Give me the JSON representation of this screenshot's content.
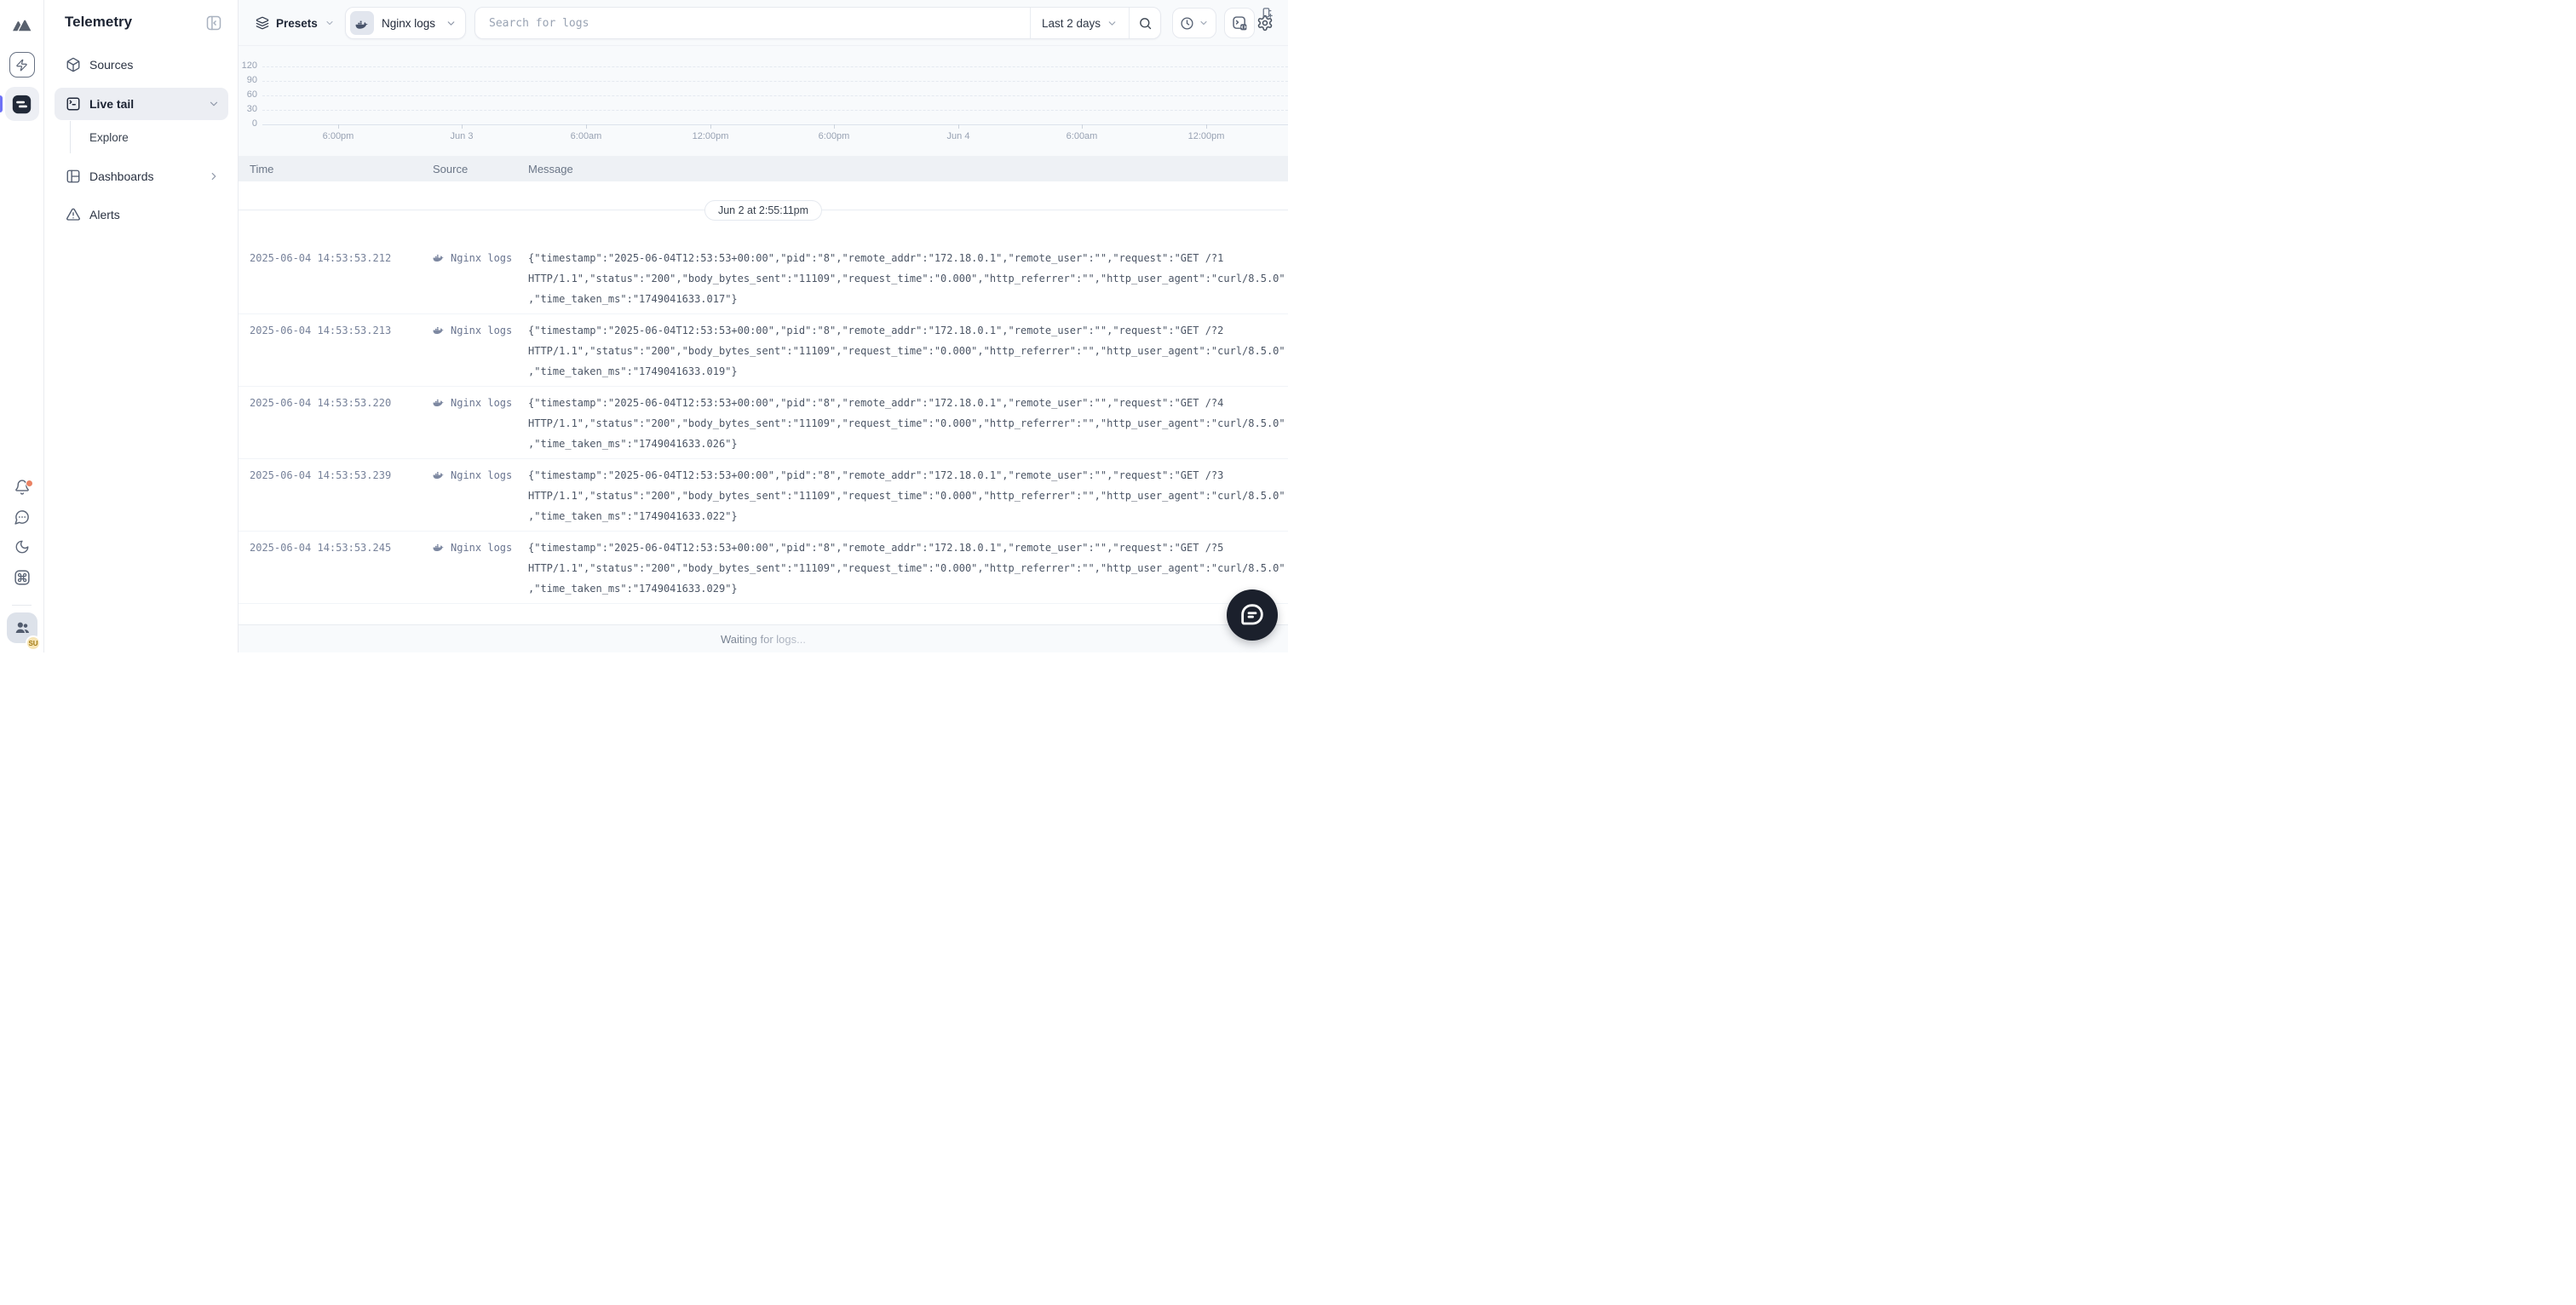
{
  "app": {
    "title": "Telemetry"
  },
  "rail": {
    "avatar_badge": "SU"
  },
  "sidebar": {
    "title": "Telemetry",
    "items": [
      {
        "label": "Sources"
      },
      {
        "label": "Live tail"
      },
      {
        "label": "Explore"
      },
      {
        "label": "Dashboards"
      },
      {
        "label": "Alerts"
      }
    ]
  },
  "topbar": {
    "presets_label": "Presets",
    "source_selector": "Nginx logs",
    "search_placeholder": "Search for logs",
    "time_range": "Last 2 days"
  },
  "chart_data": {
    "type": "bar",
    "title": "",
    "x_ticks": [
      "6:00pm",
      "Jun 3",
      "6:00am",
      "12:00pm",
      "6:00pm",
      "Jun 4",
      "6:00am",
      "12:00pm"
    ],
    "y_ticks": [
      "120",
      "90",
      "60",
      "30",
      "0"
    ],
    "ylim": [
      0,
      120
    ],
    "values": [],
    "grid": "horizontal-dashed",
    "legend": "none",
    "note": "empty histogram, no bars rendered"
  },
  "log_table": {
    "columns": [
      "Time",
      "Source",
      "Message"
    ],
    "date_separator": "Jun 2 at 2:55:11pm",
    "rows": [
      {
        "time": "2025-06-04 14:53:53.212",
        "source": "Nginx logs",
        "message": "{\"timestamp\":\"2025-06-04T12:53:53+00:00\",\"pid\":\"8\",\"remote_addr\":\"172.18.0.1\",\"remote_user\":\"\",\"request\":\"GET /?1 HTTP/1.1\",\"status\":\"200\",\"body_bytes_sent\":\"11109\",\"request_time\":\"0.000\",\"http_referrer\":\"\",\"http_user_agent\":\"curl/8.5.0\",\"time_taken_ms\":\"1749041633.017\"}"
      },
      {
        "time": "2025-06-04 14:53:53.213",
        "source": "Nginx logs",
        "message": "{\"timestamp\":\"2025-06-04T12:53:53+00:00\",\"pid\":\"8\",\"remote_addr\":\"172.18.0.1\",\"remote_user\":\"\",\"request\":\"GET /?2 HTTP/1.1\",\"status\":\"200\",\"body_bytes_sent\":\"11109\",\"request_time\":\"0.000\",\"http_referrer\":\"\",\"http_user_agent\":\"curl/8.5.0\",\"time_taken_ms\":\"1749041633.019\"}"
      },
      {
        "time": "2025-06-04 14:53:53.220",
        "source": "Nginx logs",
        "message": "{\"timestamp\":\"2025-06-04T12:53:53+00:00\",\"pid\":\"8\",\"remote_addr\":\"172.18.0.1\",\"remote_user\":\"\",\"request\":\"GET /?4 HTTP/1.1\",\"status\":\"200\",\"body_bytes_sent\":\"11109\",\"request_time\":\"0.000\",\"http_referrer\":\"\",\"http_user_agent\":\"curl/8.5.0\",\"time_taken_ms\":\"1749041633.026\"}"
      },
      {
        "time": "2025-06-04 14:53:53.239",
        "source": "Nginx logs",
        "message": "{\"timestamp\":\"2025-06-04T12:53:53+00:00\",\"pid\":\"8\",\"remote_addr\":\"172.18.0.1\",\"remote_user\":\"\",\"request\":\"GET /?3 HTTP/1.1\",\"status\":\"200\",\"body_bytes_sent\":\"11109\",\"request_time\":\"0.000\",\"http_referrer\":\"\",\"http_user_agent\":\"curl/8.5.0\",\"time_taken_ms\":\"1749041633.022\"}"
      },
      {
        "time": "2025-06-04 14:53:53.245",
        "source": "Nginx logs",
        "message": "{\"timestamp\":\"2025-06-04T12:53:53+00:00\",\"pid\":\"8\",\"remote_addr\":\"172.18.0.1\",\"remote_user\":\"\",\"request\":\"GET /?5 HTTP/1.1\",\"status\":\"200\",\"body_bytes_sent\":\"11109\",\"request_time\":\"0.000\",\"http_referrer\":\"\",\"http_user_agent\":\"curl/8.5.0\",\"time_taken_ms\":\"1749041633.029\"}"
      }
    ],
    "footer_status": "Waiting for logs..."
  },
  "colors": {
    "accent_purple": "#6e72f6",
    "notification_dot": "#ea8263",
    "header_band": "#eef1f5",
    "canvas": "#f8fafc",
    "fab_bg": "#1b202c",
    "badge_bg": "#f7e5b5"
  }
}
